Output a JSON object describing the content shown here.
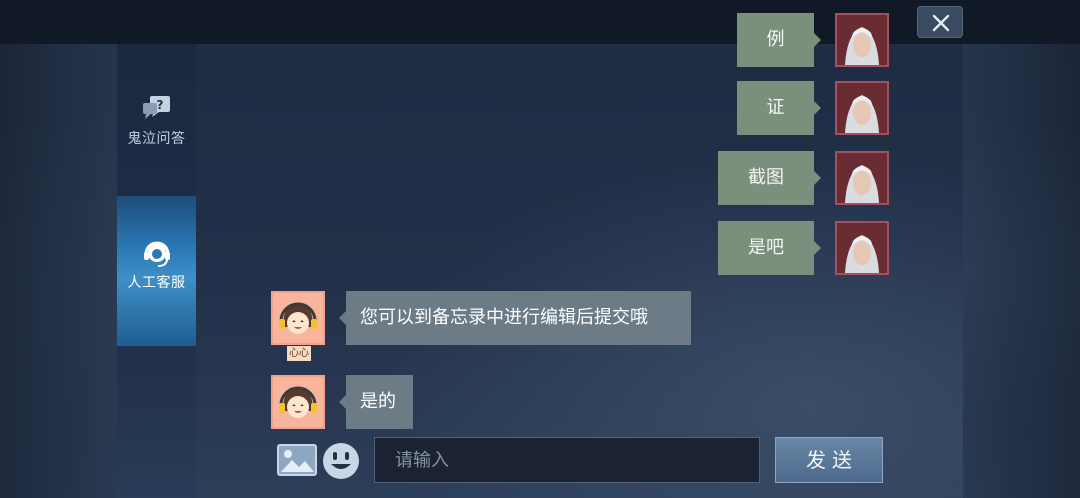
{
  "window": {
    "close_icon": "close-icon"
  },
  "sidebar": {
    "items": [
      {
        "label": "鬼泣问答",
        "icon": "question-chat-icon",
        "active": false
      },
      {
        "label": "人工客服",
        "icon": "headset-icon",
        "active": true
      }
    ]
  },
  "chat": {
    "messages": [
      {
        "from": "user",
        "text": "例"
      },
      {
        "from": "user",
        "text": "证"
      },
      {
        "from": "user",
        "text": "截图"
      },
      {
        "from": "user",
        "text": "是吧"
      },
      {
        "from": "agent",
        "text": "您可以到备忘录中进行编辑后提交哦",
        "name": "心心"
      },
      {
        "from": "agent",
        "text": "是的"
      }
    ]
  },
  "composer": {
    "placeholder": "请输入",
    "value": "",
    "send_label": "发送",
    "image_icon": "image-icon",
    "emoji_icon": "emoji-icon"
  },
  "colors": {
    "user_bubble": "#7a8f7c",
    "agent_bubble": "#6c7b86",
    "active_tab": "#2a79b5"
  }
}
